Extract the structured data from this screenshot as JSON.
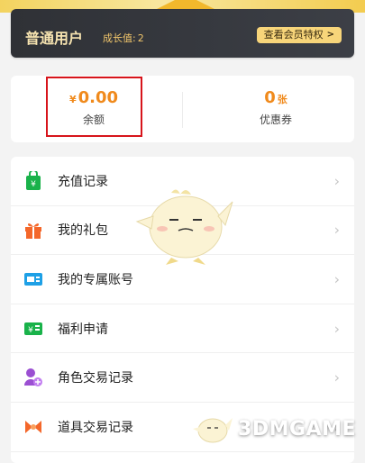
{
  "member": {
    "title": "普通用户",
    "growth_label": "成长值:",
    "growth_value": "2",
    "view_privileges": "查看会员特权"
  },
  "wallet": {
    "currency_symbol": "¥",
    "balance_value": "0.00",
    "balance_label": "余额",
    "coupon_count": "0",
    "coupon_unit": "张",
    "coupon_label": "优惠券"
  },
  "menu": {
    "items": [
      {
        "label": "充值记录",
        "icon": "recharge-bag-icon"
      },
      {
        "label": "我的礼包",
        "icon": "gift-icon"
      },
      {
        "label": "我的专属账号",
        "icon": "account-card-icon"
      },
      {
        "label": "福利申请",
        "icon": "welfare-voucher-icon"
      },
      {
        "label": "角色交易记录",
        "icon": "role-trade-icon"
      },
      {
        "label": "道具交易记录",
        "icon": "item-trade-icon"
      }
    ]
  },
  "watermark": {
    "text": "3DMGAME"
  },
  "colors": {
    "accent_orange": "#f08a1c",
    "member_card_bg": "#2f3136",
    "gold_text": "#f6e3b0",
    "highlight_red": "#d7141b"
  }
}
